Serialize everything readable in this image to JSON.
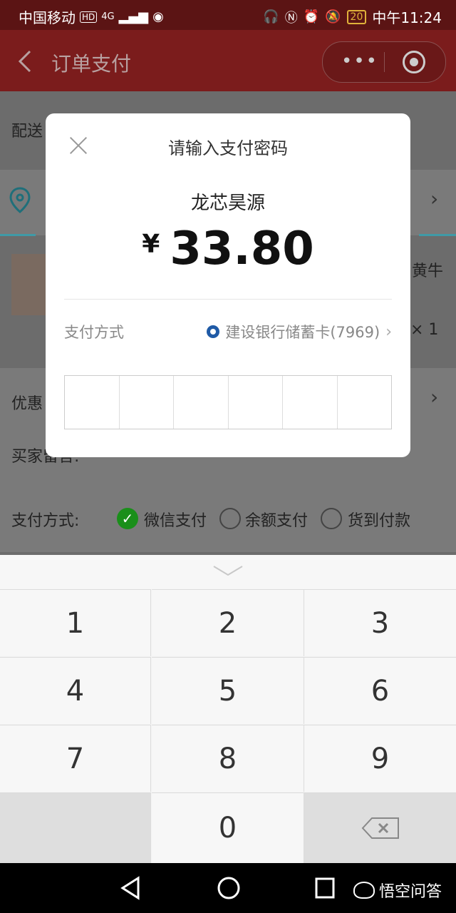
{
  "status_bar": {
    "carrier": "中国移动",
    "network": "HD",
    "signal": "4G",
    "battery": "20",
    "time": "中午11:24"
  },
  "navbar": {
    "title": "订单支付"
  },
  "background_page": {
    "delivery_label": "配送",
    "discount_label": "优惠",
    "buyer_message_label": "买家留言:",
    "product_name_fragment": "黄牛",
    "quantity": "× 1",
    "payment_method_label": "支付方式:",
    "payment_options": [
      "微信支付",
      "余额支付",
      "货到付款"
    ]
  },
  "dialog": {
    "title": "请输入支付密码",
    "merchant": "龙芯昊源",
    "currency_symbol": "¥",
    "amount": "33.80",
    "payment_label": "支付方式",
    "payment_value": "建设银行储蓄卡(7969)"
  },
  "keypad": {
    "keys": [
      "1",
      "2",
      "3",
      "4",
      "5",
      "6",
      "7",
      "8",
      "9",
      "0"
    ]
  },
  "watermark": {
    "text": "悟空问答"
  }
}
